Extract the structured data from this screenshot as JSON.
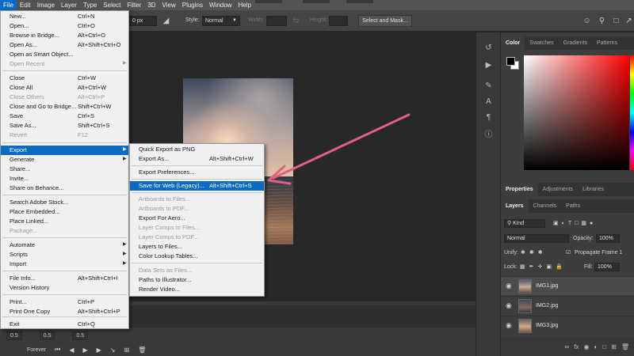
{
  "menubar": {
    "items": [
      "File",
      "Edit",
      "Image",
      "Layer",
      "Type",
      "Select",
      "Filter",
      "3D",
      "View",
      "Plugins",
      "Window",
      "Help"
    ],
    "active": "File"
  },
  "options": {
    "feather_value": "0 px",
    "style_label": "Style:",
    "style_value": "Normal",
    "width_label": "Width:",
    "height_label": "Height:",
    "select_mask_label": "Select and Mask..."
  },
  "file_menu": {
    "items": [
      {
        "label": "New...",
        "shortcut": "Ctrl+N"
      },
      {
        "label": "Open...",
        "shortcut": "Ctrl+O"
      },
      {
        "label": "Browse in Bridge...",
        "shortcut": "Alt+Ctrl+O"
      },
      {
        "label": "Open As...",
        "shortcut": "Alt+Shift+Ctrl+O"
      },
      {
        "label": "Open as Smart Object...",
        "shortcut": ""
      },
      {
        "label": "Open Recent",
        "shortcut": "",
        "submenu": true,
        "disabled": true
      },
      {
        "label": "Close",
        "shortcut": "Ctrl+W"
      },
      {
        "label": "Close All",
        "shortcut": "Alt+Ctrl+W"
      },
      {
        "label": "Close Others",
        "shortcut": "Alt+Ctrl+P",
        "disabled": true
      },
      {
        "label": "Close and Go to Bridge...",
        "shortcut": "Shift+Ctrl+W"
      },
      {
        "label": "Save",
        "shortcut": "Ctrl+S"
      },
      {
        "label": "Save As...",
        "shortcut": "Shift+Ctrl+S"
      },
      {
        "label": "Revert",
        "shortcut": "F12",
        "disabled": true
      },
      {
        "label": "Export",
        "shortcut": "",
        "submenu": true,
        "highlighted": true
      },
      {
        "label": "Generate",
        "shortcut": "",
        "submenu": true
      },
      {
        "label": "Share...",
        "shortcut": ""
      },
      {
        "label": "Invite...",
        "shortcut": ""
      },
      {
        "label": "Share on Behance...",
        "shortcut": ""
      },
      {
        "label": "Search Adobe Stock...",
        "shortcut": ""
      },
      {
        "label": "Place Embedded...",
        "shortcut": ""
      },
      {
        "label": "Place Linked...",
        "shortcut": ""
      },
      {
        "label": "Package...",
        "shortcut": "",
        "disabled": true
      },
      {
        "label": "Automate",
        "shortcut": "",
        "submenu": true
      },
      {
        "label": "Scripts",
        "shortcut": "",
        "submenu": true
      },
      {
        "label": "Import",
        "shortcut": "",
        "submenu": true
      },
      {
        "label": "File Info...",
        "shortcut": "Alt+Shift+Ctrl+I"
      },
      {
        "label": "Version History",
        "shortcut": ""
      },
      {
        "label": "Print...",
        "shortcut": "Ctrl+P"
      },
      {
        "label": "Print One Copy",
        "shortcut": "Alt+Shift+Ctrl+P"
      },
      {
        "label": "Exit",
        "shortcut": "Ctrl+Q"
      }
    ]
  },
  "export_menu": {
    "items": [
      {
        "label": "Quick Export as PNG",
        "shortcut": ""
      },
      {
        "label": "Export As...",
        "shortcut": "Alt+Shift+Ctrl+W"
      },
      {
        "label": "Export Preferences...",
        "shortcut": ""
      },
      {
        "label": "Save for Web (Legacy)...",
        "shortcut": "Alt+Shift+Ctrl+S",
        "highlighted": true
      },
      {
        "label": "Artboards to Files...",
        "shortcut": "",
        "disabled": true
      },
      {
        "label": "Artboards to PDF...",
        "shortcut": "",
        "disabled": true
      },
      {
        "label": "Export For Aero...",
        "shortcut": ""
      },
      {
        "label": "Layer Comps to Files...",
        "shortcut": "",
        "disabled": true
      },
      {
        "label": "Layer Comps to PDF...",
        "shortcut": "",
        "disabled": true
      },
      {
        "label": "Layers to Files...",
        "shortcut": ""
      },
      {
        "label": "Color Lookup Tables...",
        "shortcut": ""
      },
      {
        "label": "Data Sets as Files...",
        "shortcut": "",
        "disabled": true
      },
      {
        "label": "Paths to Illustrator...",
        "shortcut": ""
      },
      {
        "label": "Render Video...",
        "shortcut": ""
      }
    ]
  },
  "timeline": {
    "frame_times": [
      "0.5",
      "0.5",
      "0.5"
    ],
    "loop": "Forever"
  },
  "color_panel": {
    "tabs": [
      "Color",
      "Swatches",
      "Gradients",
      "Patterns"
    ],
    "foreground": "#000000",
    "background": "#ffffff"
  },
  "properties_panel": {
    "tabs": [
      "Properties",
      "Adjustments",
      "Libraries"
    ]
  },
  "layers_panel": {
    "tabs": [
      "Layers",
      "Channels",
      "Paths"
    ],
    "kind_label": "Kind",
    "blend_mode": "Normal",
    "opacity_label": "Opacity:",
    "opacity_value": "100%",
    "unify_label": "Unify:",
    "propagate_label": "Propagate Frame 1",
    "lock_label": "Lock:",
    "fill_label": "Fill:",
    "fill_value": "100%",
    "layers": [
      {
        "name": "IMG1.jpg",
        "selected": true
      },
      {
        "name": "IMG2.jpg",
        "selected": false
      },
      {
        "name": "IMG3.jpg",
        "selected": false
      }
    ]
  },
  "colors": {
    "menu_highlight": "#0a6bc2",
    "arrow": "#e0607e"
  }
}
